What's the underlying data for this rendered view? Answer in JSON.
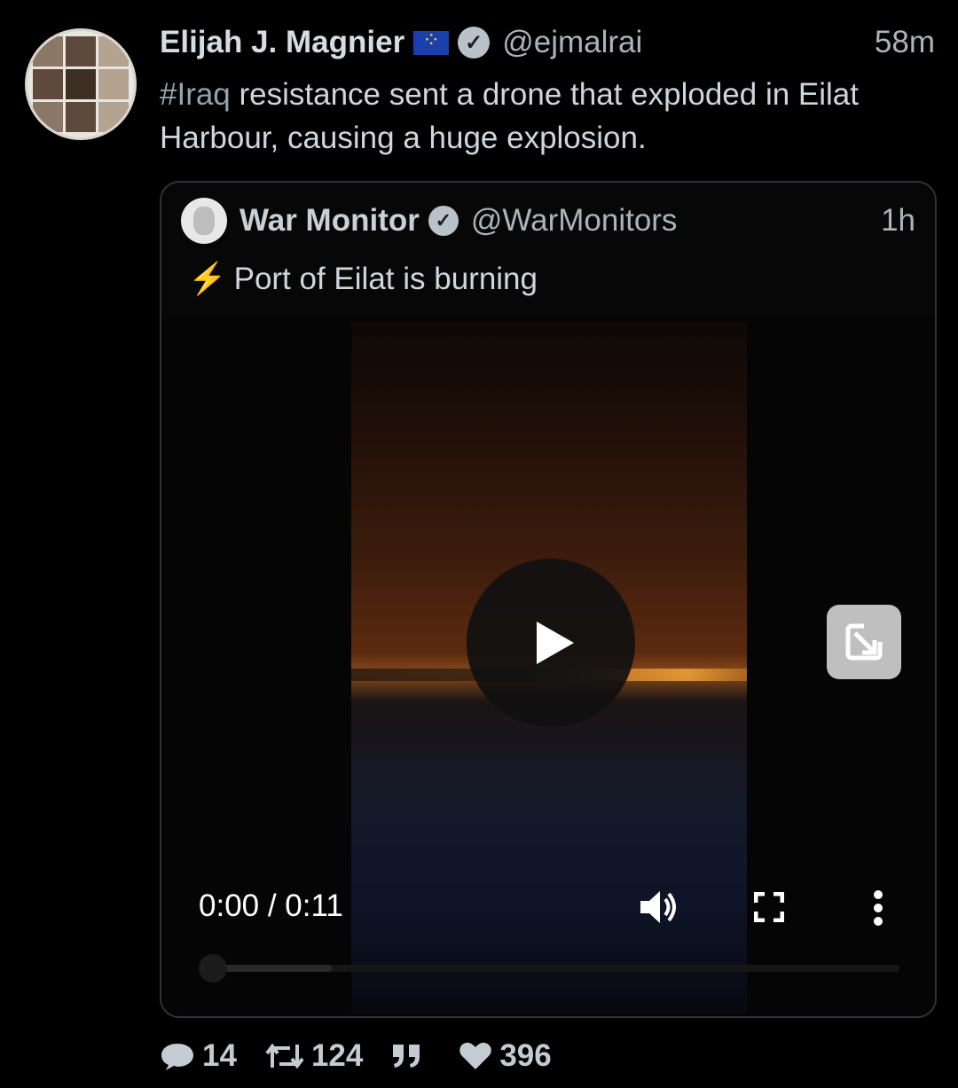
{
  "tweet": {
    "author_name": "Elijah J. Magnier",
    "author_handle": "@ejmalrai",
    "time": "58m",
    "hashtag": "#Iraq",
    "text": " resistance sent a drone that exploded in Eilat Harbour, causing a huge explosion."
  },
  "quoted": {
    "author_name": "War Monitor",
    "author_handle": "@WarMonitors",
    "time": "1h",
    "text": "Port of Eilat is burning",
    "video": {
      "time_display": "0:00 / 0:11",
      "progress": 0.0,
      "buffered": 0.19
    }
  },
  "actions": {
    "replies": "14",
    "retweets": "124",
    "likes": "396"
  },
  "colors": {
    "background": "#000000",
    "text": "#cfd6dc",
    "hashtag": "#8fa5b2",
    "card_border": "#2f3336"
  }
}
